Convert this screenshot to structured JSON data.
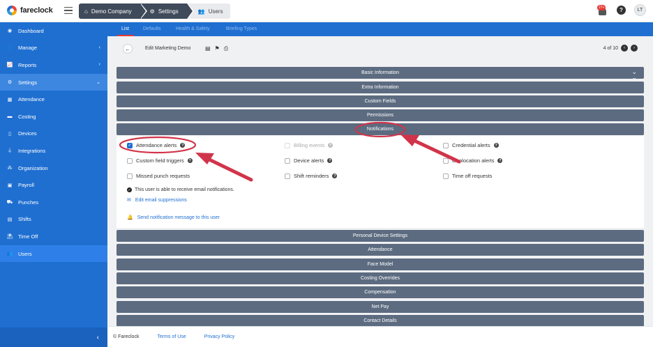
{
  "app": {
    "logo_text": "fareclock"
  },
  "breadcrumb": [
    {
      "label": "Demo Company",
      "icon": "home-icon"
    },
    {
      "label": "Settings",
      "icon": "gear-icon"
    },
    {
      "label": "Users",
      "icon": "users-icon"
    }
  ],
  "header": {
    "notifications_badge": "27+",
    "help_label": "?",
    "avatar_initials": "LT"
  },
  "sidebar": {
    "items": [
      {
        "label": "Dashboard",
        "icon": "dashboard-icon"
      },
      {
        "label": "Manage",
        "icon": "person-icon"
      },
      {
        "label": "Reports",
        "icon": "chart-icon"
      },
      {
        "label": "Settings",
        "icon": "gear-icon"
      },
      {
        "label": "Attendance",
        "icon": "attendance-icon"
      },
      {
        "label": "Costing",
        "icon": "folder-icon"
      },
      {
        "label": "Devices",
        "icon": "tablet-icon"
      },
      {
        "label": "Integrations",
        "icon": "plug-icon"
      },
      {
        "label": "Organization",
        "icon": "org-icon"
      },
      {
        "label": "Payroll",
        "icon": "money-icon"
      },
      {
        "label": "Punches",
        "icon": "truck-icon"
      },
      {
        "label": "Shifts",
        "icon": "clipboard-icon"
      },
      {
        "label": "Time Off",
        "icon": "beach-icon"
      },
      {
        "label": "Users",
        "icon": "users-icon"
      }
    ],
    "collapse_glyph": "‹"
  },
  "tabs": [
    {
      "label": "List"
    },
    {
      "label": "Defaults"
    },
    {
      "label": "Health & Safety"
    },
    {
      "label": "Briefing Types"
    }
  ],
  "toolbar": {
    "back_glyph": "←",
    "title": "Edit Marketing Demo",
    "pager_text": "4 of 10"
  },
  "sections": {
    "basic": "Basic Information",
    "extra": "Extra Information",
    "custom": "Custom Fields",
    "permissions": "Permissions",
    "notifications": "Notifications",
    "personal_device": "Personal Device Settings",
    "attendance": "Attendance",
    "face_model": "Face Model",
    "costing_overrides": "Costing Overrides",
    "compensation": "Compensation",
    "net_pay": "Net Pay",
    "contact_details": "Contact Details"
  },
  "notifications": {
    "checkboxes": [
      {
        "label": "Attendance alerts",
        "checked": true
      },
      {
        "label": "Billing events",
        "checked": false,
        "disabled": true
      },
      {
        "label": "Credential alerts",
        "checked": false
      },
      {
        "label": "Custom field triggers",
        "checked": false
      },
      {
        "label": "Device alerts",
        "checked": false
      },
      {
        "label": "Geolocation alerts",
        "checked": false
      },
      {
        "label": "Missed punch requests",
        "checked": false
      },
      {
        "label": "Shift reminders",
        "checked": false
      },
      {
        "label": "Time off requests",
        "checked": false
      }
    ],
    "email_status": "This user is able to receive email notifications.",
    "edit_suppressions": "Edit email suppressions",
    "send_message": "Send notification message to this user"
  },
  "footer": {
    "copyright": "© Fareclock",
    "terms": "Terms of Use",
    "privacy": "Privacy Policy"
  },
  "colors": {
    "primary": "#1f6fd1",
    "section_bar": "#5c6b80",
    "annotation": "#d1344a"
  }
}
